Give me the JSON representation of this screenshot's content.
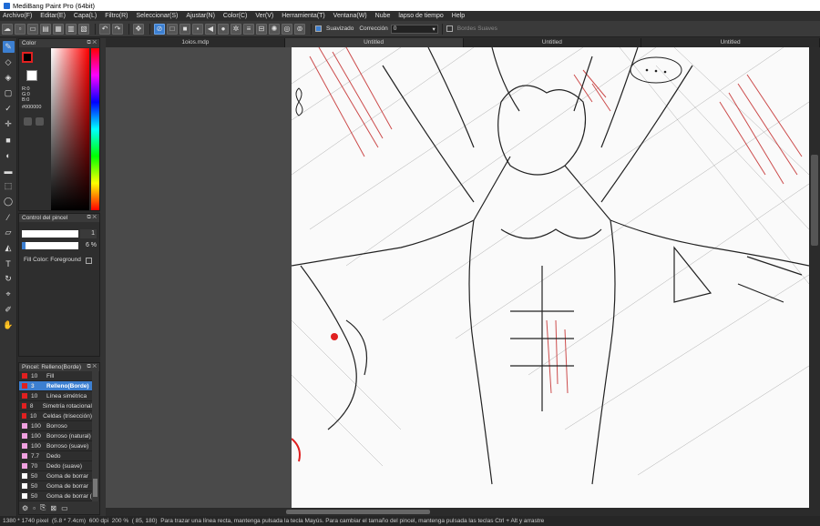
{
  "window": {
    "title": "MediBang Paint Pro (64bit)"
  },
  "menu": [
    "Archivo(F)",
    "Editar(E)",
    "Capa(L)",
    "Filtro(R)",
    "Seleccionar(S)",
    "Ajustar(N)",
    "Color(C)",
    "Ver(V)",
    "Herramienta(T)",
    "Ventana(W)",
    "Nube",
    "lapso de tiempo",
    "Help"
  ],
  "toolbar": {
    "suavizado_label": "Suavizado",
    "correccion_label": "Corrección",
    "correccion_value": "0",
    "bordes_label": "Bordes Suaves"
  },
  "tabs": [
    "1oios.mdp",
    "Untitled",
    "Untitled",
    "Untitled"
  ],
  "color_panel": {
    "title": "Color",
    "r": "R:0",
    "g": "G:0",
    "b": "B:0",
    "hex": "#000000",
    "primary": "#000000",
    "accent": "#ff0000"
  },
  "brush_control": {
    "title": "Control del pincel",
    "size_value": "1",
    "opacity_value": "6 %",
    "fill_color_label": "Fill Color: Foreground"
  },
  "brush_panel": {
    "title": "Pincel: Relleno(Borde)",
    "items": [
      {
        "size": "10",
        "name": "Fill",
        "color": "#e02020"
      },
      {
        "size": "3",
        "name": "Relleno(Borde)",
        "color": "#e02020"
      },
      {
        "size": "10",
        "name": "Línea simétrica",
        "color": "#e02020"
      },
      {
        "size": "8",
        "name": "Simetría rotacional",
        "color": "#e02020"
      },
      {
        "size": "10",
        "name": "Celdas (trisección)",
        "color": "#e02020"
      },
      {
        "size": "100",
        "name": "Borroso",
        "color": "#f0a0e0"
      },
      {
        "size": "100",
        "name": "Borroso (natural)",
        "color": "#f0a0e0"
      },
      {
        "size": "100",
        "name": "Borroso (suave)",
        "color": "#f0a0e0"
      },
      {
        "size": "7.7",
        "name": "Dedo",
        "color": "#f0a0e0"
      },
      {
        "size": "70",
        "name": "Dedo (suave)",
        "color": "#f0a0e0"
      },
      {
        "size": "50",
        "name": "Goma de borrar",
        "color": "#ffffff"
      },
      {
        "size": "50",
        "name": "Goma de borrar",
        "color": "#ffffff"
      },
      {
        "size": "50",
        "name": "Goma de borrar (",
        "color": "#ffffff"
      }
    ]
  },
  "status": {
    "canvas_size": "1380 * 1740 pixel",
    "physical": "(5.8 * 7.4cm)",
    "dpi": "600 dpi",
    "zoom": "200 %",
    "coords": "( 85, 180)",
    "hint": "Para trazar una línea recta, mantenga pulsada la tecla Mayús. Para cambiar el tamaño del pincel, mantenga pulsada las teclas Ctrl + Alt y arrastre"
  },
  "icons": [
    "pen-icon",
    "eraser-icon",
    "fill-icon",
    "select-rect-icon",
    "magic-wand-icon",
    "move-icon",
    "shape-rect-icon",
    "bucket-icon",
    "gradient-icon",
    "lasso-icon",
    "text-icon",
    "eyedropper-icon",
    "hand-icon"
  ]
}
